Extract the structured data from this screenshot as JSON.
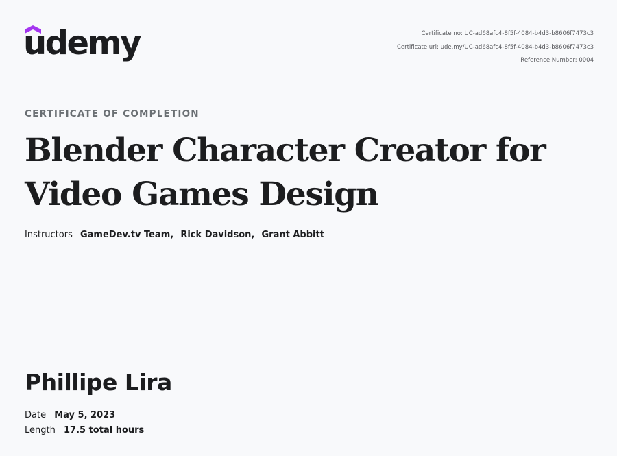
{
  "brand": {
    "name": "udemy",
    "accent_color": "#a435f0",
    "logo_icon": "udemy-logo-icon"
  },
  "certificate_meta": {
    "certificate_no": "Certificate no: UC-ad68afc4-8f5f-4084-b4d3-b8606f7473c3",
    "certificate_url": "Certificate url: ude.my/UC-ad68afc4-8f5f-4084-b4d3-b8606f7473c3",
    "reference_number": "Reference Number: 0004"
  },
  "eyebrow": "CERTIFICATE OF COMPLETION",
  "course": {
    "title_line1": "Blender Character Creator for",
    "title_line2": "Video Games Design"
  },
  "instructors": {
    "label": "Instructors",
    "names": [
      "GameDev.tv Team",
      "Rick Davidson",
      "Grant Abbitt"
    ],
    "separator": ","
  },
  "recipient": {
    "name": "Phillipe Lira"
  },
  "details": {
    "date_label": "Date",
    "date_value": "May 5, 2023",
    "length_label": "Length",
    "length_value": "17.5 total hours"
  },
  "colors": {
    "background": "#f8f9fb",
    "text": "#1c1d1f",
    "muted": "#6a6f73"
  }
}
